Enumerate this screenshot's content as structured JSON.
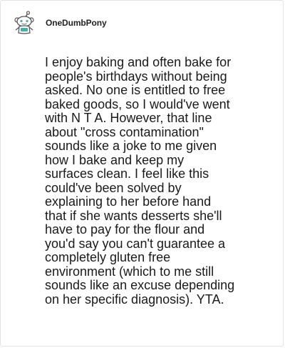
{
  "comment": {
    "username": "OneDumbPony",
    "avatar_icon": "snoo-avatar-icon",
    "body": "I enjoy baking and often bake for\npeople's birthdays without being\nasked. No one is entitled to free\nbaked goods, so I would've went\nwith N T A. However, that line\nabout \"cross contamination\"\nsounds like a joke to me given\nhow I bake and keep my\nsurfaces clean. I feel like this\ncould've been solved by\nexplaining to her before hand\nthat if she wants desserts she'll\nhave to pay for the flour and\nyou'd say you can't guarantee a\ncompletely gluten free\nenvironment (which to me still\nsounds like an excuse depending\non her specific diagnosis). YTA."
  },
  "colors": {
    "text": "#1a1a1a",
    "username": "#222222",
    "border": "#e3e3e3",
    "avatar_accent": "#3fb3a5"
  }
}
